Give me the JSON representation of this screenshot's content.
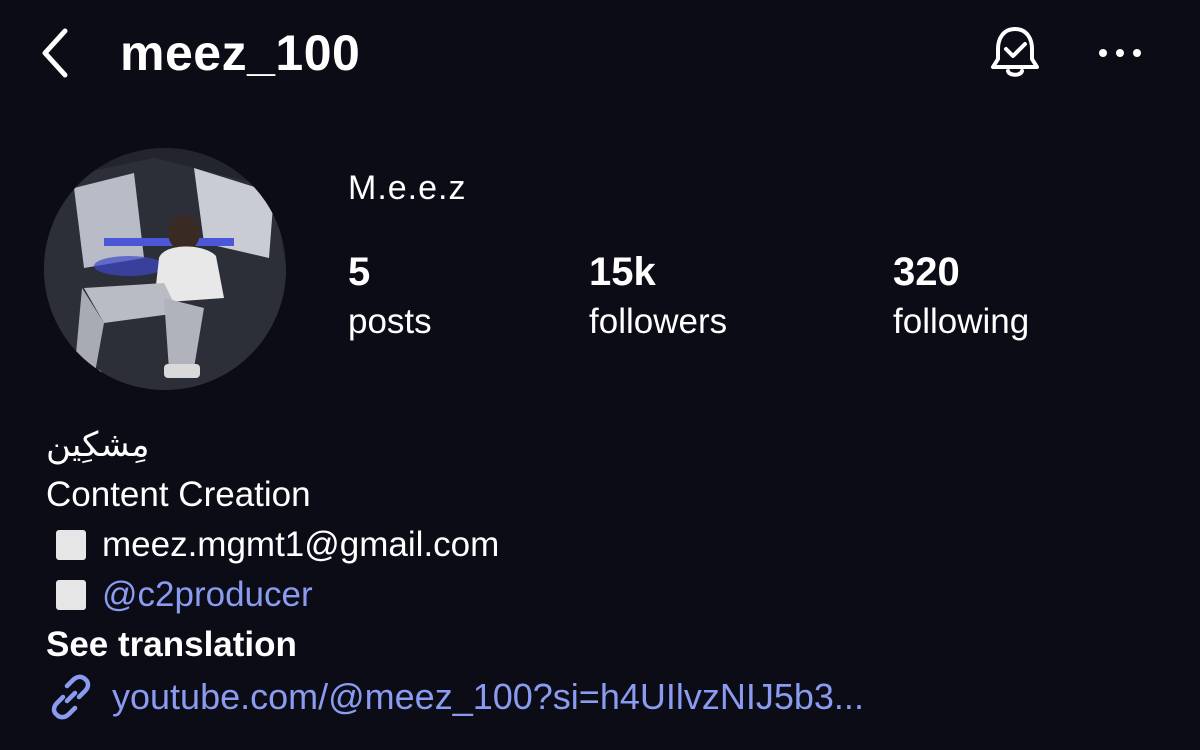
{
  "header": {
    "username": "meez_100"
  },
  "profile": {
    "display_name": "M.e.e.z",
    "stats": [
      {
        "value": "5",
        "label": "posts"
      },
      {
        "value": "15k",
        "label": "followers"
      },
      {
        "value": "320",
        "label": "following"
      }
    ]
  },
  "bio": {
    "arabic_line": "مِشكِين",
    "category": "Content Creation",
    "email": "meez.mgmt1@gmail.com",
    "mention": "@c2producer",
    "see_translation": "See translation",
    "link": "youtube.com/@meez_100?si=h4UIlvzNIJ5b3..."
  },
  "icons": {
    "back": "chevron-left-icon",
    "bell": "bell-check-icon",
    "more": "more-horizontal-icon",
    "link": "link-icon"
  },
  "colors": {
    "background": "#0b0c15",
    "text": "#ffffff",
    "link": "#8a9bf1"
  }
}
